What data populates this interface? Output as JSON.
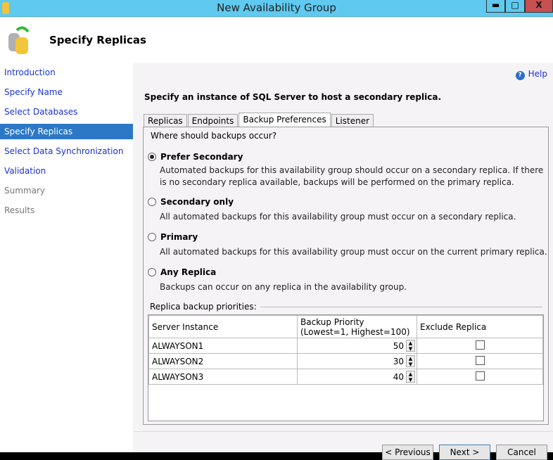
{
  "window": {
    "title": "New Availability Group",
    "min": "▬",
    "max": "□",
    "close": "X"
  },
  "header": {
    "title": "Specify Replicas"
  },
  "sidebar": {
    "items": [
      {
        "label": "Introduction"
      },
      {
        "label": "Specify Name"
      },
      {
        "label": "Select Databases"
      },
      {
        "label": "Specify Replicas"
      },
      {
        "label": "Select Data Synchronization"
      },
      {
        "label": "Validation"
      },
      {
        "label": "Summary"
      },
      {
        "label": "Results"
      }
    ]
  },
  "help": "Help",
  "lead": "Specify an instance of SQL Server to host a secondary replica.",
  "tabs": [
    "Replicas",
    "Endpoints",
    "Backup Preferences",
    "Listener"
  ],
  "question": "Where should backups occur?",
  "options": [
    {
      "label": "Prefer Secondary",
      "desc": "Automated backups for this availability group should occur on a secondary replica. If there is no secondary replica available, backups will be performed on the primary replica.",
      "selected": true
    },
    {
      "label": "Secondary only",
      "desc": "All automated backups for this availability group must occur on a secondary replica.",
      "selected": false
    },
    {
      "label": "Primary",
      "desc": "All automated backups for this availability group must occur on the current primary replica.",
      "selected": false
    },
    {
      "label": "Any Replica",
      "desc": "Backups can occur on any replica in the availability group.",
      "selected": false
    }
  ],
  "priorities_label": "Replica backup priorities:",
  "table": {
    "headers": [
      "Server Instance",
      "Backup Priority",
      "(Lowest=1, Highest=100)",
      "Exclude Replica"
    ],
    "rows": [
      {
        "server": "ALWAYSON1",
        "priority": "50",
        "exclude": false
      },
      {
        "server": "ALWAYSON2",
        "priority": "30",
        "exclude": false
      },
      {
        "server": "ALWAYSON3",
        "priority": "40",
        "exclude": false
      }
    ]
  },
  "buttons": {
    "previous": "< Previous",
    "next": "Next >",
    "cancel": "Cancel"
  }
}
